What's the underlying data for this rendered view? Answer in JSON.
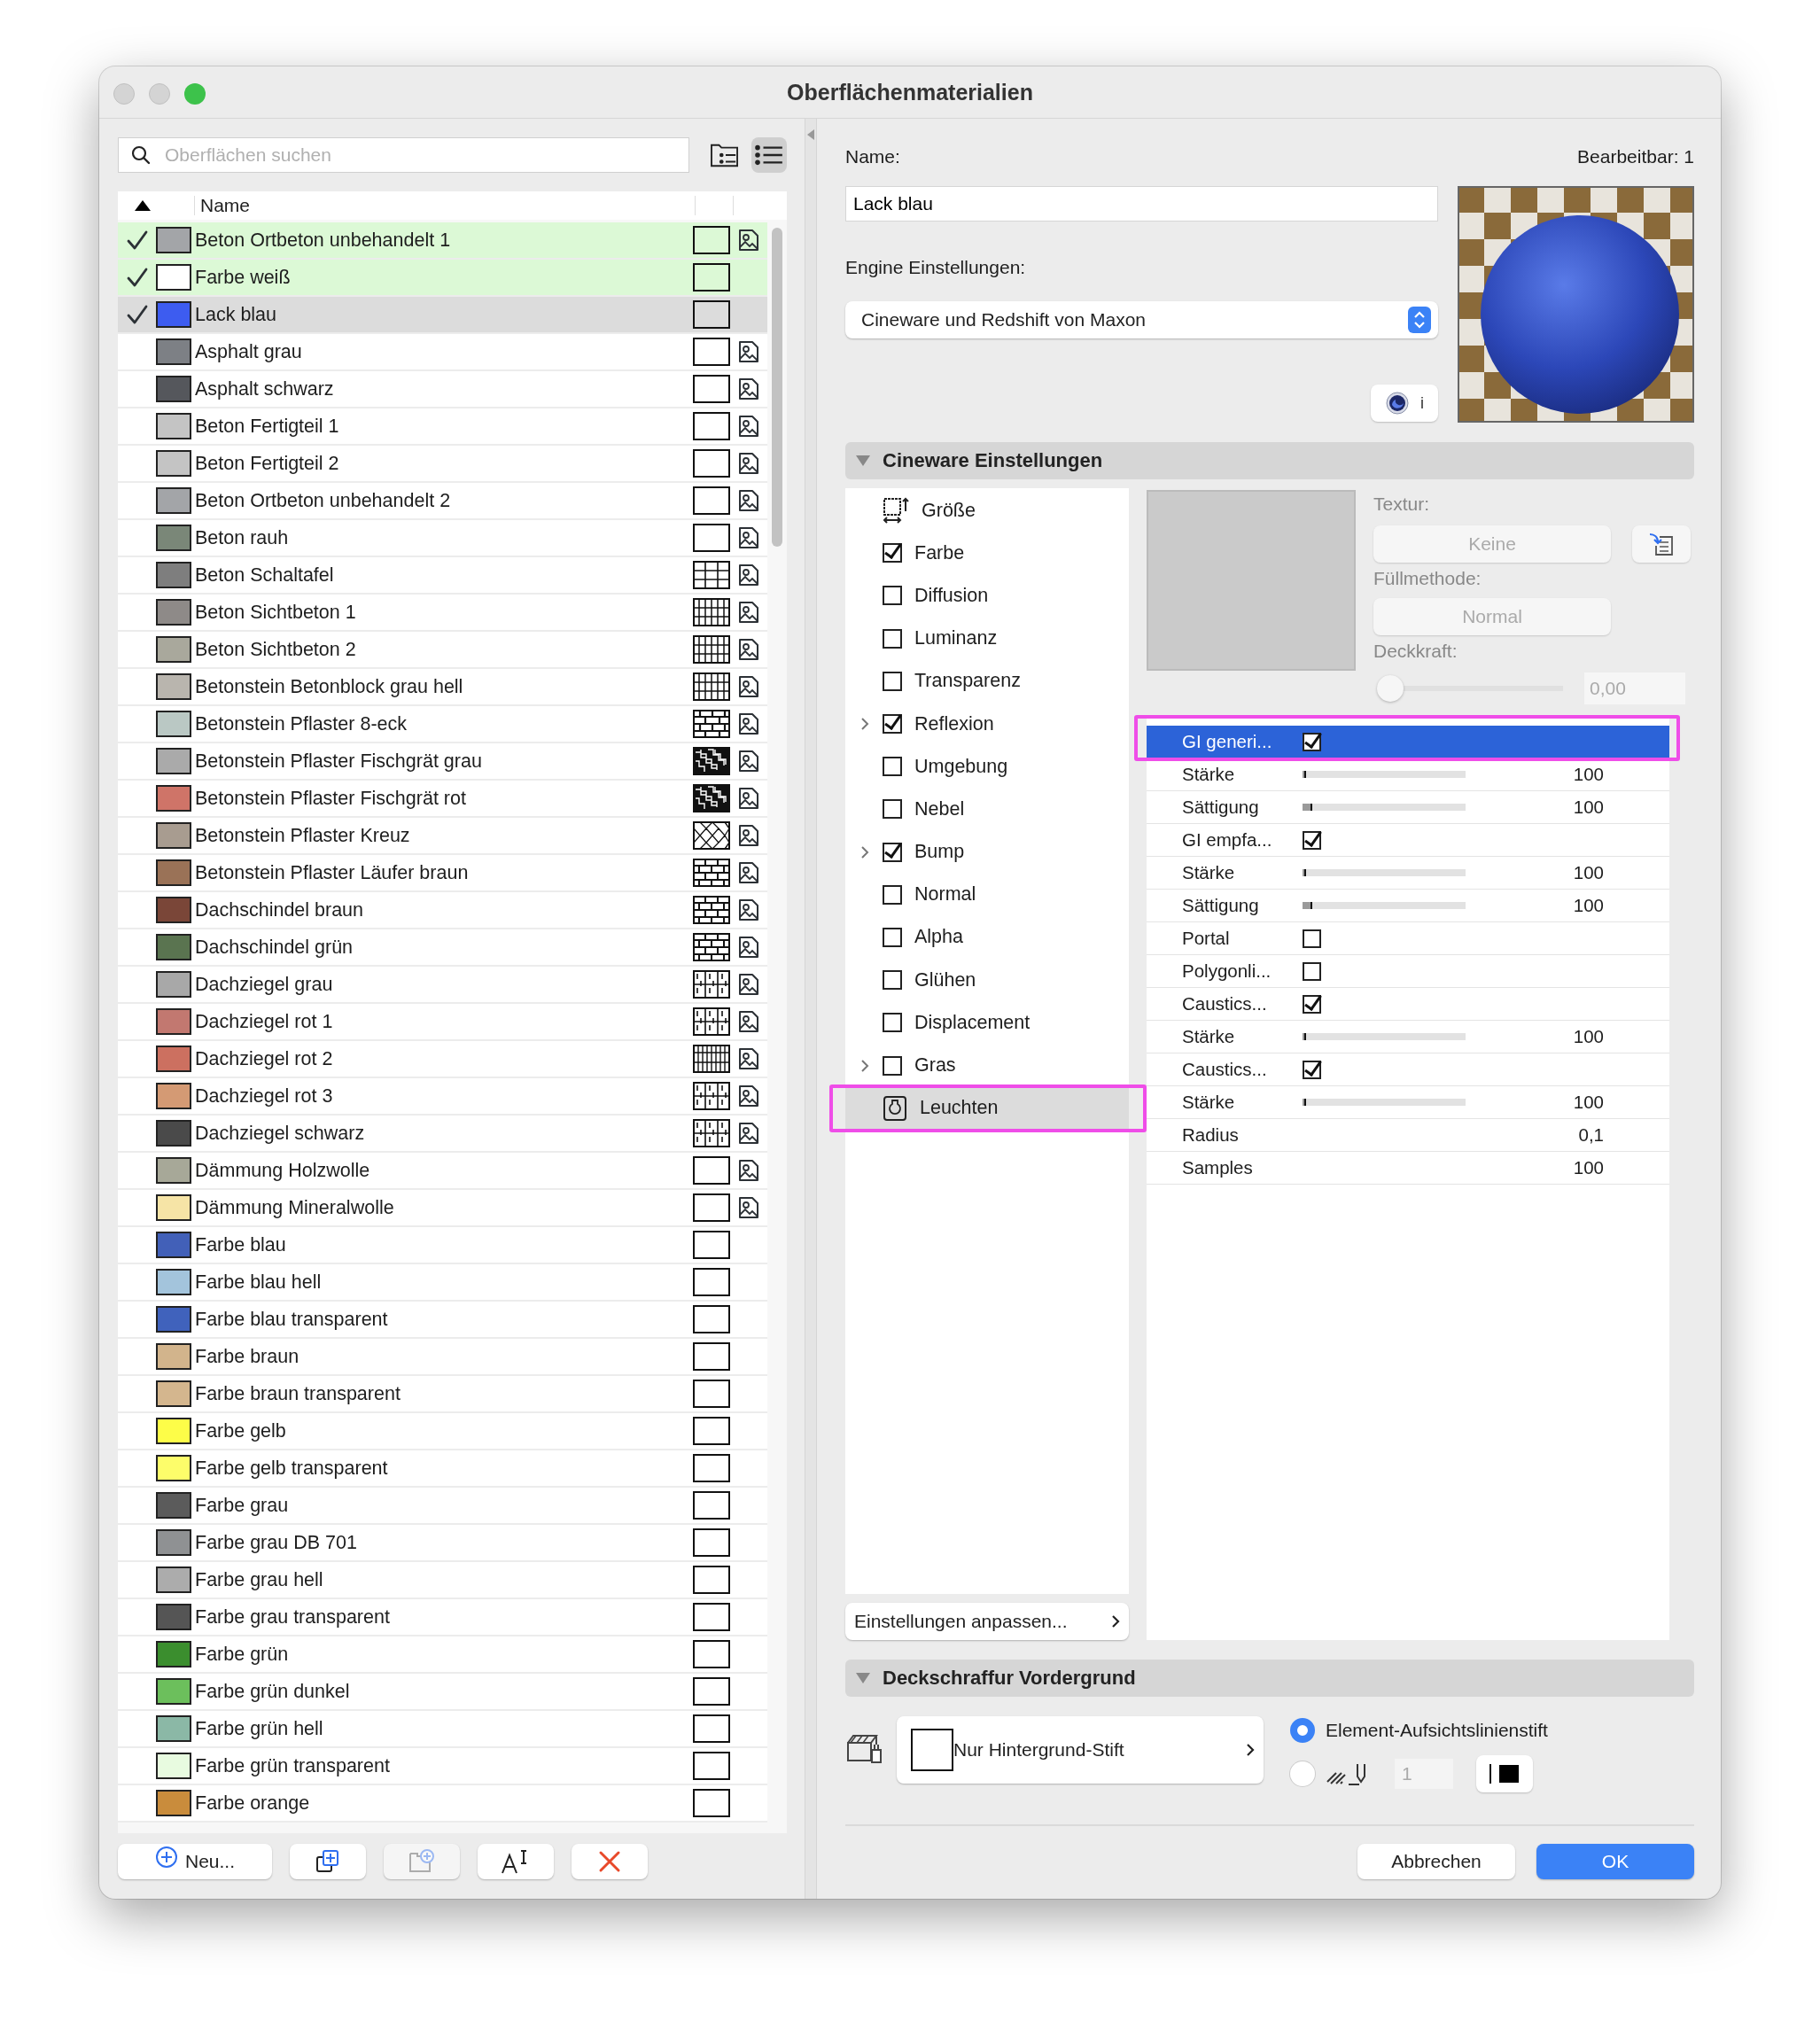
{
  "window": {
    "title": "Oberflächenmaterialien"
  },
  "search": {
    "placeholder": "Oberflächen suchen"
  },
  "view_toggle": [
    {
      "kind": "folders",
      "selected": false
    },
    {
      "kind": "list",
      "selected": true
    }
  ],
  "table": {
    "sort_ascending": true,
    "columns": [
      "Name"
    ]
  },
  "materials": [
    {
      "name": "Beton Ortbeton unbehandelt 1",
      "color": "#a3a5a8",
      "in_use": true,
      "selected": false,
      "kind": "empty",
      "texture": true
    },
    {
      "name": "Farbe weiß",
      "color": "#ffffff",
      "in_use": true,
      "selected": false,
      "kind": "empty",
      "texture": false
    },
    {
      "name": "Lack blau",
      "color": "#3d5cf0",
      "in_use": true,
      "selected": true,
      "kind": "empty",
      "texture": false
    },
    {
      "name": "Asphalt grau",
      "color": "#7d8085",
      "in_use": false,
      "selected": false,
      "kind": "empty",
      "texture": true
    },
    {
      "name": "Asphalt schwarz",
      "color": "#55575c",
      "in_use": false,
      "selected": false,
      "kind": "empty",
      "texture": true
    },
    {
      "name": "Beton Fertigteil 1",
      "color": "#c4c4c4",
      "in_use": false,
      "selected": false,
      "kind": "empty",
      "texture": true
    },
    {
      "name": "Beton Fertigteil 2",
      "color": "#c4c4c4",
      "in_use": false,
      "selected": false,
      "kind": "empty",
      "texture": true
    },
    {
      "name": "Beton Ortbeton unbehandelt 2",
      "color": "#a3a5a8",
      "in_use": false,
      "selected": false,
      "kind": "empty",
      "texture": true
    },
    {
      "name": "Beton rauh",
      "color": "#7a8778",
      "in_use": false,
      "selected": false,
      "kind": "empty",
      "texture": true
    },
    {
      "name": "Beton Schaltafel",
      "color": "#7e7e7e",
      "in_use": false,
      "selected": false,
      "kind": "grid",
      "texture": true
    },
    {
      "name": "Beton Sichtbeton 1",
      "color": "#8e8a88",
      "in_use": false,
      "selected": false,
      "kind": "vertical",
      "texture": true
    },
    {
      "name": "Beton Sichtbeton 2",
      "color": "#a9a89c",
      "in_use": false,
      "selected": false,
      "kind": "vertical",
      "texture": true
    },
    {
      "name": "Betonstein Betonblock grau hell",
      "color": "#b9b5ae",
      "in_use": false,
      "selected": false,
      "kind": "vertical",
      "texture": true
    },
    {
      "name": "Betonstein Pflaster 8-eck",
      "color": "#bac8c4",
      "in_use": false,
      "selected": false,
      "kind": "blocks",
      "texture": true
    },
    {
      "name": "Betonstein Pflaster Fischgrät grau",
      "color": "#aaaaaa",
      "in_use": false,
      "selected": false,
      "kind": "herringbone",
      "texture": true
    },
    {
      "name": "Betonstein Pflaster Fischgrät rot",
      "color": "#cf7468",
      "in_use": false,
      "selected": false,
      "kind": "herringbone",
      "texture": true
    },
    {
      "name": "Betonstein Pflaster Kreuz",
      "color": "#a89c90",
      "in_use": false,
      "selected": false,
      "kind": "lattice",
      "texture": true
    },
    {
      "name": "Betonstein Pflaster Läufer braun",
      "color": "#9a7257",
      "in_use": false,
      "selected": false,
      "kind": "brick",
      "texture": true
    },
    {
      "name": "Dachschindel braun",
      "color": "#7a4638",
      "in_use": false,
      "selected": false,
      "kind": "brick",
      "texture": true
    },
    {
      "name": "Dachschindel grün",
      "color": "#5a7450",
      "in_use": false,
      "selected": false,
      "kind": "brick",
      "texture": true
    },
    {
      "name": "Dachziegel grau",
      "color": "#a8a8a8",
      "in_use": false,
      "selected": false,
      "kind": "tiles",
      "texture": true
    },
    {
      "name": "Dachziegel rot 1",
      "color": "#c27870",
      "in_use": false,
      "selected": false,
      "kind": "tiles",
      "texture": true
    },
    {
      "name": "Dachziegel rot 2",
      "color": "#cc7060",
      "in_use": false,
      "selected": false,
      "kind": "fine",
      "texture": true
    },
    {
      "name": "Dachziegel rot 3",
      "color": "#d49a74",
      "in_use": false,
      "selected": false,
      "kind": "tiles",
      "texture": true
    },
    {
      "name": "Dachziegel schwarz",
      "color": "#4a4a4a",
      "in_use": false,
      "selected": false,
      "kind": "tiles",
      "texture": true
    },
    {
      "name": "Dämmung Holzwolle",
      "color": "#a7a898",
      "in_use": false,
      "selected": false,
      "kind": "empty",
      "texture": true
    },
    {
      "name": "Dämmung Mineralwolle",
      "color": "#f6e4a6",
      "in_use": false,
      "selected": false,
      "kind": "empty",
      "texture": true
    },
    {
      "name": "Farbe blau",
      "color": "#4260b8",
      "in_use": false,
      "selected": false,
      "kind": "empty",
      "texture": false
    },
    {
      "name": "Farbe blau hell",
      "color": "#a3c4dc",
      "in_use": false,
      "selected": false,
      "kind": "empty",
      "texture": false
    },
    {
      "name": "Farbe blau transparent",
      "color": "#4062bc",
      "in_use": false,
      "selected": false,
      "kind": "empty",
      "texture": false
    },
    {
      "name": "Farbe braun",
      "color": "#d2b48c",
      "in_use": false,
      "selected": false,
      "kind": "empty",
      "texture": false
    },
    {
      "name": "Farbe braun transparent",
      "color": "#d4b68e",
      "in_use": false,
      "selected": false,
      "kind": "empty",
      "texture": false
    },
    {
      "name": "Farbe gelb",
      "color": "#fdfd48",
      "in_use": false,
      "selected": false,
      "kind": "empty",
      "texture": false
    },
    {
      "name": "Farbe gelb transparent",
      "color": "#fdfd6a",
      "in_use": false,
      "selected": false,
      "kind": "empty",
      "texture": false
    },
    {
      "name": "Farbe grau",
      "color": "#5b5b5b",
      "in_use": false,
      "selected": false,
      "kind": "empty",
      "texture": false
    },
    {
      "name": "Farbe grau DB 701",
      "color": "#8f9193",
      "in_use": false,
      "selected": false,
      "kind": "empty",
      "texture": false
    },
    {
      "name": "Farbe grau hell",
      "color": "#acacac",
      "in_use": false,
      "selected": false,
      "kind": "empty",
      "texture": false
    },
    {
      "name": "Farbe grau transparent",
      "color": "#555555",
      "in_use": false,
      "selected": false,
      "kind": "empty",
      "texture": false
    },
    {
      "name": "Farbe grün",
      "color": "#3b8e2e",
      "in_use": false,
      "selected": false,
      "kind": "empty",
      "texture": false
    },
    {
      "name": "Farbe grün dunkel",
      "color": "#6cbf5c",
      "in_use": false,
      "selected": false,
      "kind": "empty",
      "texture": false
    },
    {
      "name": "Farbe grün hell",
      "color": "#8bb8a6",
      "in_use": false,
      "selected": false,
      "kind": "empty",
      "texture": false
    },
    {
      "name": "Farbe grün transparent",
      "color": "#e8fbe0",
      "in_use": false,
      "selected": false,
      "kind": "empty",
      "texture": false
    },
    {
      "name": "Farbe orange",
      "color": "#c98c3c",
      "in_use": false,
      "selected": false,
      "kind": "empty",
      "texture": false
    }
  ],
  "left_buttons": [
    {
      "kind": "new",
      "label": "Neu...",
      "disabled": false
    },
    {
      "kind": "duplicate",
      "disabled": false
    },
    {
      "kind": "new_folder",
      "disabled": true
    },
    {
      "kind": "rename",
      "disabled": false
    },
    {
      "kind": "delete",
      "disabled": false
    }
  ],
  "editor": {
    "name_label": "Name:",
    "editable": "Bearbeitbar: 1",
    "name_value": "Lack blau",
    "engine_label": "Engine Einstellungen:",
    "engine_value": "Cineware und Redshift von Maxon",
    "info_button": "i"
  },
  "cineware": {
    "title": "Cineware Einstellungen",
    "expanded": true,
    "channels": [
      {
        "label": "Größe",
        "kind": "size",
        "expandable": false,
        "selected": false,
        "highlighted": false
      },
      {
        "label": "Farbe",
        "kind": "checkbox",
        "expandable": false,
        "checked": true,
        "selected": false,
        "highlighted": false
      },
      {
        "label": "Diffusion",
        "kind": "checkbox",
        "expandable": false,
        "checked": false,
        "selected": false,
        "highlighted": false
      },
      {
        "label": "Luminanz",
        "kind": "checkbox",
        "expandable": false,
        "checked": false,
        "selected": false,
        "highlighted": false
      },
      {
        "label": "Transparenz",
        "kind": "checkbox",
        "expandable": false,
        "checked": false,
        "selected": false,
        "highlighted": false
      },
      {
        "label": "Reflexion",
        "kind": "checkbox",
        "expandable": true,
        "checked": true,
        "selected": false,
        "highlighted": false
      },
      {
        "label": "Umgebung",
        "kind": "checkbox",
        "expandable": false,
        "checked": false,
        "selected": false,
        "highlighted": false
      },
      {
        "label": "Nebel",
        "kind": "checkbox",
        "expandable": false,
        "checked": false,
        "selected": false,
        "highlighted": false
      },
      {
        "label": "Bump",
        "kind": "checkbox",
        "expandable": true,
        "checked": true,
        "selected": false,
        "highlighted": false
      },
      {
        "label": "Normal",
        "kind": "checkbox",
        "expandable": false,
        "checked": false,
        "selected": false,
        "highlighted": false
      },
      {
        "label": "Alpha",
        "kind": "checkbox",
        "expandable": false,
        "checked": false,
        "selected": false,
        "highlighted": false
      },
      {
        "label": "Glühen",
        "kind": "checkbox",
        "expandable": false,
        "checked": false,
        "selected": false,
        "highlighted": false
      },
      {
        "label": "Displacement",
        "kind": "checkbox",
        "expandable": false,
        "checked": false,
        "selected": false,
        "highlighted": false
      },
      {
        "label": "Gras",
        "kind": "checkbox",
        "expandable": true,
        "checked": false,
        "selected": false,
        "highlighted": false
      },
      {
        "label": "Leuchten",
        "kind": "lamp",
        "expandable": false,
        "selected": true,
        "highlighted": true
      }
    ],
    "customize_button": "Einstellungen anpassen...",
    "texture": {
      "texture_label": "Textur:",
      "texture_value": "Keine",
      "fill_label": "Füllmethode:",
      "fill_value": "Normal",
      "opacity_label": "Deckkraft:",
      "level": 0,
      "opacity_value": "0,00",
      "disabled": true
    },
    "properties": [
      {
        "label": "GI generi...",
        "kind": "checkbox",
        "checked": true,
        "selected": true,
        "highlighted": true
      },
      {
        "label": "Stärke",
        "kind": "slider",
        "level": 0.01,
        "value": "100",
        "selected": false,
        "highlighted": false
      },
      {
        "label": "Sättigung",
        "kind": "slider",
        "level": 0.05,
        "value": "100",
        "selected": false,
        "highlighted": false
      },
      {
        "label": "GI empfa...",
        "kind": "checkbox",
        "checked": true,
        "selected": false,
        "highlighted": false
      },
      {
        "label": "Stärke",
        "kind": "slider",
        "level": 0.01,
        "value": "100",
        "selected": false,
        "highlighted": false
      },
      {
        "label": "Sättigung",
        "kind": "slider",
        "level": 0.05,
        "value": "100",
        "selected": false,
        "highlighted": false
      },
      {
        "label": "Portal",
        "kind": "checkbox",
        "checked": false,
        "selected": false,
        "highlighted": false
      },
      {
        "label": "Polygonli...",
        "kind": "checkbox",
        "checked": false,
        "selected": false,
        "highlighted": false
      },
      {
        "label": "Caustics...",
        "kind": "checkbox",
        "checked": true,
        "selected": false,
        "highlighted": false
      },
      {
        "label": "Stärke",
        "kind": "slider",
        "level": 0.01,
        "value": "100",
        "selected": false,
        "highlighted": false
      },
      {
        "label": "Caustics...",
        "kind": "checkbox",
        "checked": true,
        "selected": false,
        "highlighted": false
      },
      {
        "label": "Stärke",
        "kind": "slider",
        "level": 0.01,
        "value": "100",
        "selected": false,
        "highlighted": false
      },
      {
        "label": "Radius",
        "kind": "value",
        "value": "0,1",
        "selected": false,
        "highlighted": false
      },
      {
        "label": "Samples",
        "kind": "value",
        "value": "100",
        "selected": false,
        "highlighted": false
      }
    ]
  },
  "hatch_section": {
    "title": "Deckschraffur Vordergrund",
    "expanded": true,
    "fill_button": "Nur Hintergrund-Stift",
    "pen_options": [
      {
        "kind": "element",
        "label": "Element-Aufsichtslinienstift",
        "selected": true
      },
      {
        "kind": "custom",
        "pen_value": "1",
        "selected": false
      }
    ]
  },
  "dialog_buttons": [
    {
      "label": "Abbrechen",
      "default": false
    },
    {
      "label": "OK",
      "default": true
    }
  ]
}
